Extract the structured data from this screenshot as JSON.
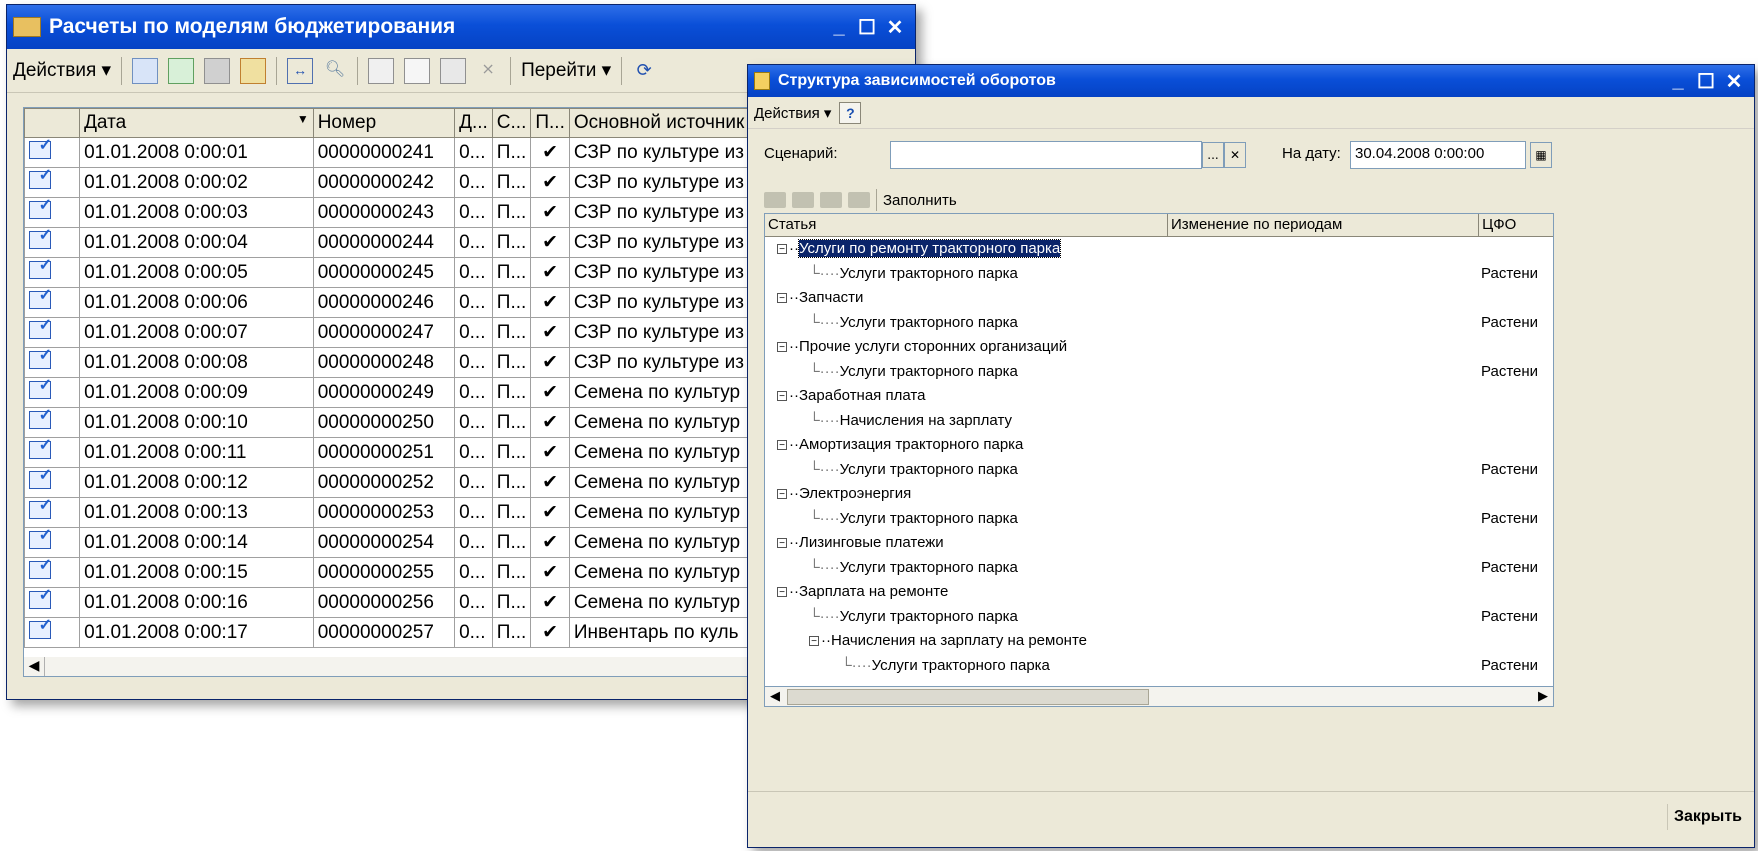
{
  "main_window": {
    "title": "Расчеты по моделям бюджетирования",
    "toolbar": {
      "actions": "Действия",
      "goto": "Перейти"
    },
    "columns": [
      "Дата",
      "Номер",
      "Д...",
      "С...",
      "П...",
      "Основной источник"
    ],
    "rows": [
      {
        "date": "01.01.2008 0:00:01",
        "number": "00000000241",
        "d": "0...",
        "s": "П...",
        "p": "✔",
        "source": "СЗР по культуре из"
      },
      {
        "date": "01.01.2008 0:00:02",
        "number": "00000000242",
        "d": "0...",
        "s": "П...",
        "p": "✔",
        "source": "СЗР по культуре из"
      },
      {
        "date": "01.01.2008 0:00:03",
        "number": "00000000243",
        "d": "0...",
        "s": "П...",
        "p": "✔",
        "source": "СЗР по культуре из"
      },
      {
        "date": "01.01.2008 0:00:04",
        "number": "00000000244",
        "d": "0...",
        "s": "П...",
        "p": "✔",
        "source": "СЗР по культуре из"
      },
      {
        "date": "01.01.2008 0:00:05",
        "number": "00000000245",
        "d": "0...",
        "s": "П...",
        "p": "✔",
        "source": "СЗР по культуре из"
      },
      {
        "date": "01.01.2008 0:00:06",
        "number": "00000000246",
        "d": "0...",
        "s": "П...",
        "p": "✔",
        "source": "СЗР по культуре из"
      },
      {
        "date": "01.01.2008 0:00:07",
        "number": "00000000247",
        "d": "0...",
        "s": "П...",
        "p": "✔",
        "source": "СЗР по культуре из"
      },
      {
        "date": "01.01.2008 0:00:08",
        "number": "00000000248",
        "d": "0...",
        "s": "П...",
        "p": "✔",
        "source": "СЗР по культуре из"
      },
      {
        "date": "01.01.2008 0:00:09",
        "number": "00000000249",
        "d": "0...",
        "s": "П...",
        "p": "✔",
        "source": "Семена по культур"
      },
      {
        "date": "01.01.2008 0:00:10",
        "number": "00000000250",
        "d": "0...",
        "s": "П...",
        "p": "✔",
        "source": "Семена по культур"
      },
      {
        "date": "01.01.2008 0:00:11",
        "number": "00000000251",
        "d": "0...",
        "s": "П...",
        "p": "✔",
        "source": "Семена по культур"
      },
      {
        "date": "01.01.2008 0:00:12",
        "number": "00000000252",
        "d": "0...",
        "s": "П...",
        "p": "✔",
        "source": "Семена по культур"
      },
      {
        "date": "01.01.2008 0:00:13",
        "number": "00000000253",
        "d": "0...",
        "s": "П...",
        "p": "✔",
        "source": "Семена по культур"
      },
      {
        "date": "01.01.2008 0:00:14",
        "number": "00000000254",
        "d": "0...",
        "s": "П...",
        "p": "✔",
        "source": "Семена по культур"
      },
      {
        "date": "01.01.2008 0:00:15",
        "number": "00000000255",
        "d": "0...",
        "s": "П...",
        "p": "✔",
        "source": "Семена по культур"
      },
      {
        "date": "01.01.2008 0:00:16",
        "number": "00000000256",
        "d": "0...",
        "s": "П...",
        "p": "✔",
        "source": "Семена по культур"
      },
      {
        "date": "01.01.2008 0:00:17",
        "number": "00000000257",
        "d": "0...",
        "s": "П...",
        "p": "✔",
        "source": "Инвентарь по куль"
      }
    ]
  },
  "dep_window": {
    "title": "Структура зависимостей оборотов",
    "toolbar": {
      "actions": "Действия",
      "help": "?"
    },
    "scenario_label": "Сценарий:",
    "scenario_value": "",
    "date_label": "На дату:",
    "date_value": "30.04.2008 0:00:00",
    "fill_label": "Заполнить",
    "columns": [
      "Статья",
      "Изменение по периодам",
      "ЦФО"
    ],
    "tree": [
      {
        "level": 0,
        "label": "Услуги по ремонту тракторного парка",
        "cfo": "",
        "selected": true
      },
      {
        "level": 1,
        "label": "Услуги тракторного парка",
        "cfo": "Растени"
      },
      {
        "level": 0,
        "label": "Запчасти",
        "cfo": ""
      },
      {
        "level": 1,
        "label": "Услуги тракторного парка",
        "cfo": "Растени"
      },
      {
        "level": 0,
        "label": "Прочие услуги сторонних организаций",
        "cfo": ""
      },
      {
        "level": 1,
        "label": "Услуги тракторного парка",
        "cfo": "Растени"
      },
      {
        "level": 0,
        "label": "Заработная плата",
        "cfo": ""
      },
      {
        "level": 1,
        "label": "Начисления на зарплату",
        "cfo": ""
      },
      {
        "level": 0,
        "label": "Амортизация  тракторного парка",
        "cfo": ""
      },
      {
        "level": 1,
        "label": "Услуги тракторного парка",
        "cfo": "Растени"
      },
      {
        "level": 0,
        "label": "Электроэнергия",
        "cfo": ""
      },
      {
        "level": 1,
        "label": "Услуги тракторного парка",
        "cfo": "Растени"
      },
      {
        "level": 0,
        "label": "Лизинговые платежи",
        "cfo": ""
      },
      {
        "level": 1,
        "label": "Услуги тракторного парка",
        "cfo": "Растени"
      },
      {
        "level": 0,
        "label": "Зарплата на ремонте",
        "cfo": ""
      },
      {
        "level": 1,
        "label": "Услуги тракторного парка",
        "cfo": "Растени"
      },
      {
        "level": 1,
        "label": "Начисления на зарплату на ремонте",
        "cfo": "",
        "expandable": true
      },
      {
        "level": 2,
        "label": "Услуги тракторного парка",
        "cfo": "Растени"
      }
    ],
    "close_label": "Закрыть"
  }
}
